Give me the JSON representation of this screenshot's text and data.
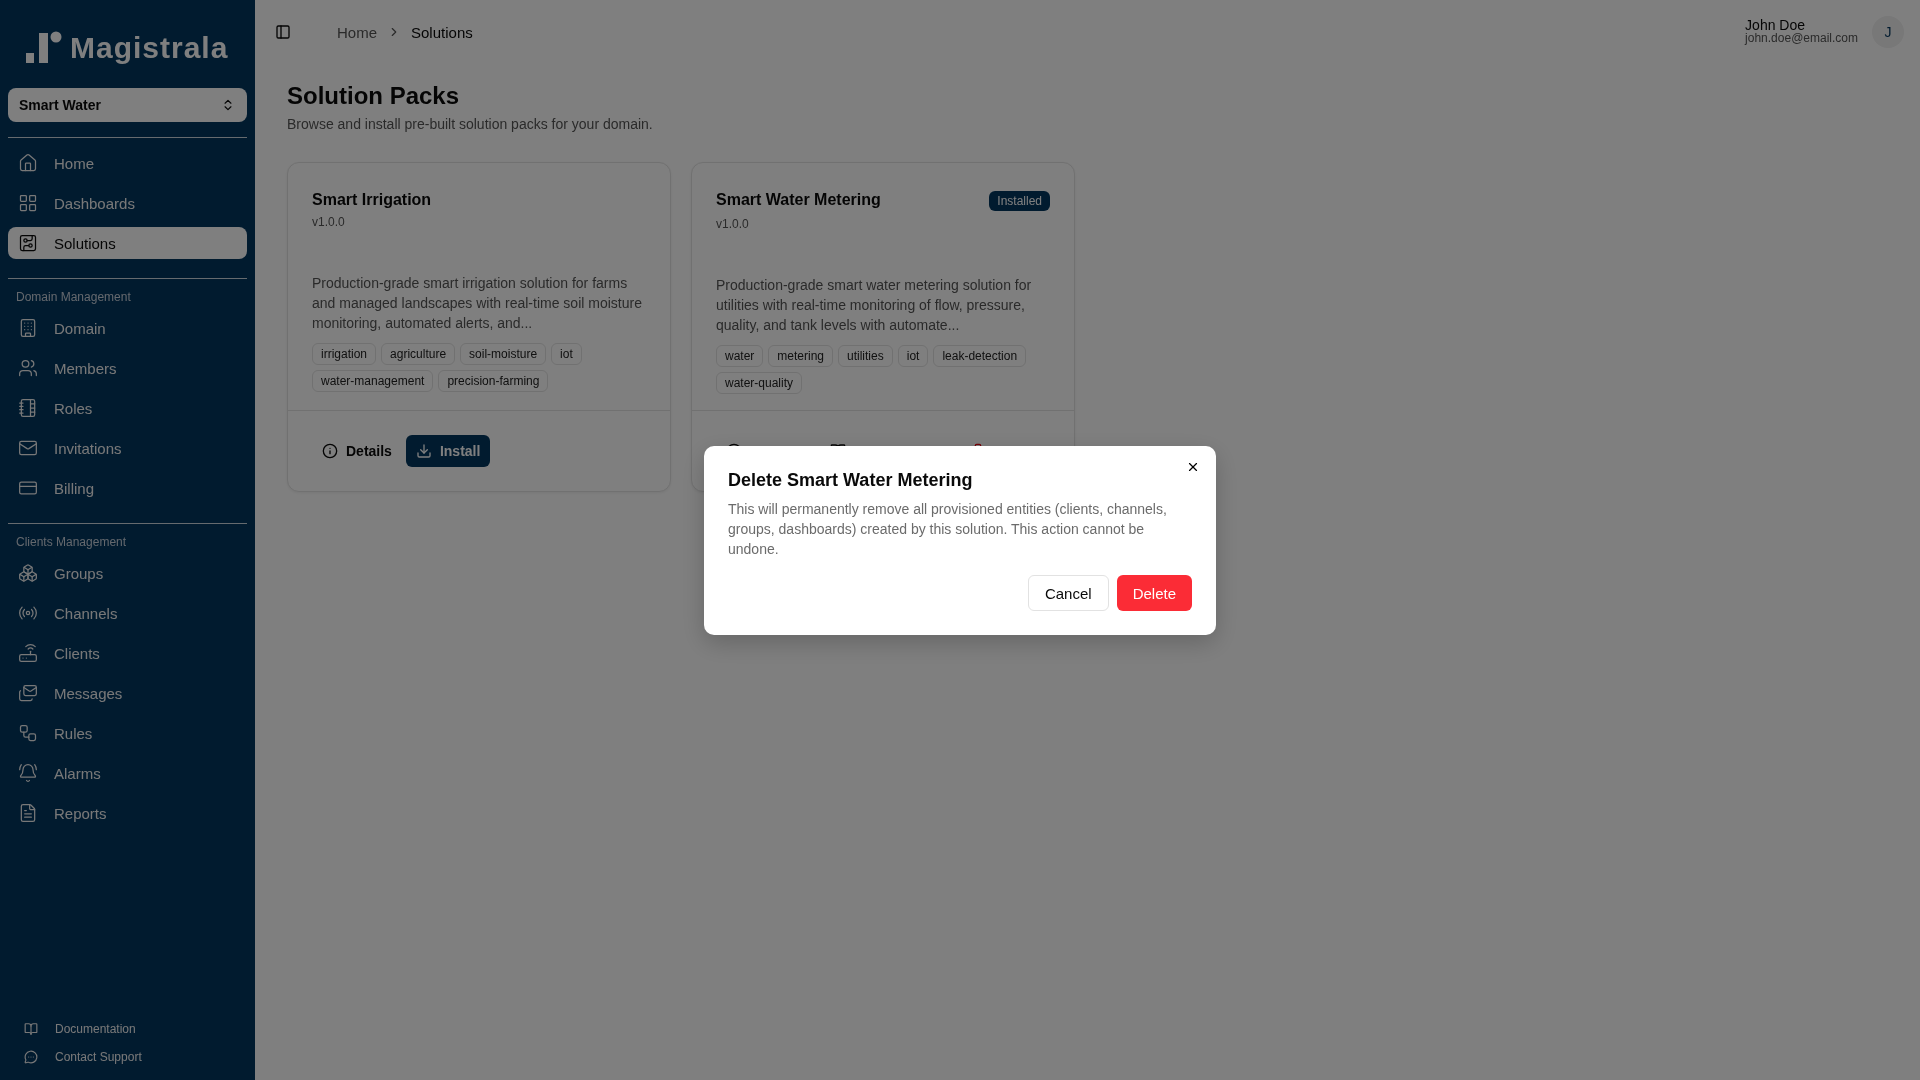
{
  "sidebar": {
    "logo": "Magistrala",
    "domain_selector": "Smart Water",
    "sections": [
      {
        "items": [
          {
            "label": "Home",
            "selected": false
          },
          {
            "label": "Dashboards",
            "selected": false
          },
          {
            "label": "Solutions",
            "selected": true
          }
        ]
      },
      {
        "heading": "Domain Management",
        "items": [
          {
            "label": "Domain",
            "selected": false
          },
          {
            "label": "Members",
            "selected": false
          },
          {
            "label": "Roles",
            "selected": false
          },
          {
            "label": "Invitations",
            "selected": false
          },
          {
            "label": "Billing",
            "selected": false
          }
        ]
      },
      {
        "heading": "Clients Management",
        "items": [
          {
            "label": "Groups",
            "selected": false
          },
          {
            "label": "Channels",
            "selected": false
          },
          {
            "label": "Clients",
            "selected": false
          },
          {
            "label": "Messages",
            "selected": false
          },
          {
            "label": "Rules",
            "selected": false
          },
          {
            "label": "Alarms",
            "selected": false
          },
          {
            "label": "Reports",
            "selected": false
          }
        ]
      }
    ],
    "footer_links": [
      "Documentation",
      "Contact Support"
    ]
  },
  "header": {
    "breadcrumbs": [
      {
        "label": "Home",
        "current": false
      },
      {
        "label": "Solutions",
        "current": true
      }
    ],
    "user": {
      "name": "John Doe",
      "email": "john.doe@email.com",
      "avatar": "J"
    }
  },
  "page": {
    "title": "Solution Packs",
    "subtitle": "Browse and install pre-built solution packs for your domain.",
    "cards": [
      {
        "title": "Smart Irrigation",
        "version": "v1.0.0",
        "description": "Production-grade smart irrigation solution for farms and managed landscapes with real-time soil moisture monitoring, automated alerts, and...",
        "tags": [
          "irrigation",
          "agriculture",
          "soil-moisture",
          "iot",
          "water-management",
          "precision-farming"
        ],
        "actions": [
          {
            "label": "Details",
            "kind": "details"
          },
          {
            "label": "Install",
            "kind": "install"
          }
        ]
      },
      {
        "title": "Smart Water Metering",
        "version": "v1.0.0",
        "badge": "Installed",
        "description": "Production-grade smart water metering solution for utilities with real-time monitoring of flow, pressure, quality, and tank levels with automate...",
        "tags": [
          "water",
          "metering",
          "utilities",
          "iot",
          "leak-detection",
          "water-quality"
        ],
        "actions": [
          {
            "kind": "details"
          },
          {
            "kind": "instructions"
          },
          {
            "kind": "delete"
          }
        ]
      }
    ]
  },
  "dialog": {
    "title": "Delete Smart Water Metering",
    "message": "This will permanently remove all provisioned entities (clients, channels, groups, dashboards) created by this solution. This action cannot be undone.",
    "buttons": [
      {
        "label": "Cancel",
        "kind": "secondary"
      },
      {
        "label": "Delete",
        "kind": "danger"
      }
    ]
  }
}
